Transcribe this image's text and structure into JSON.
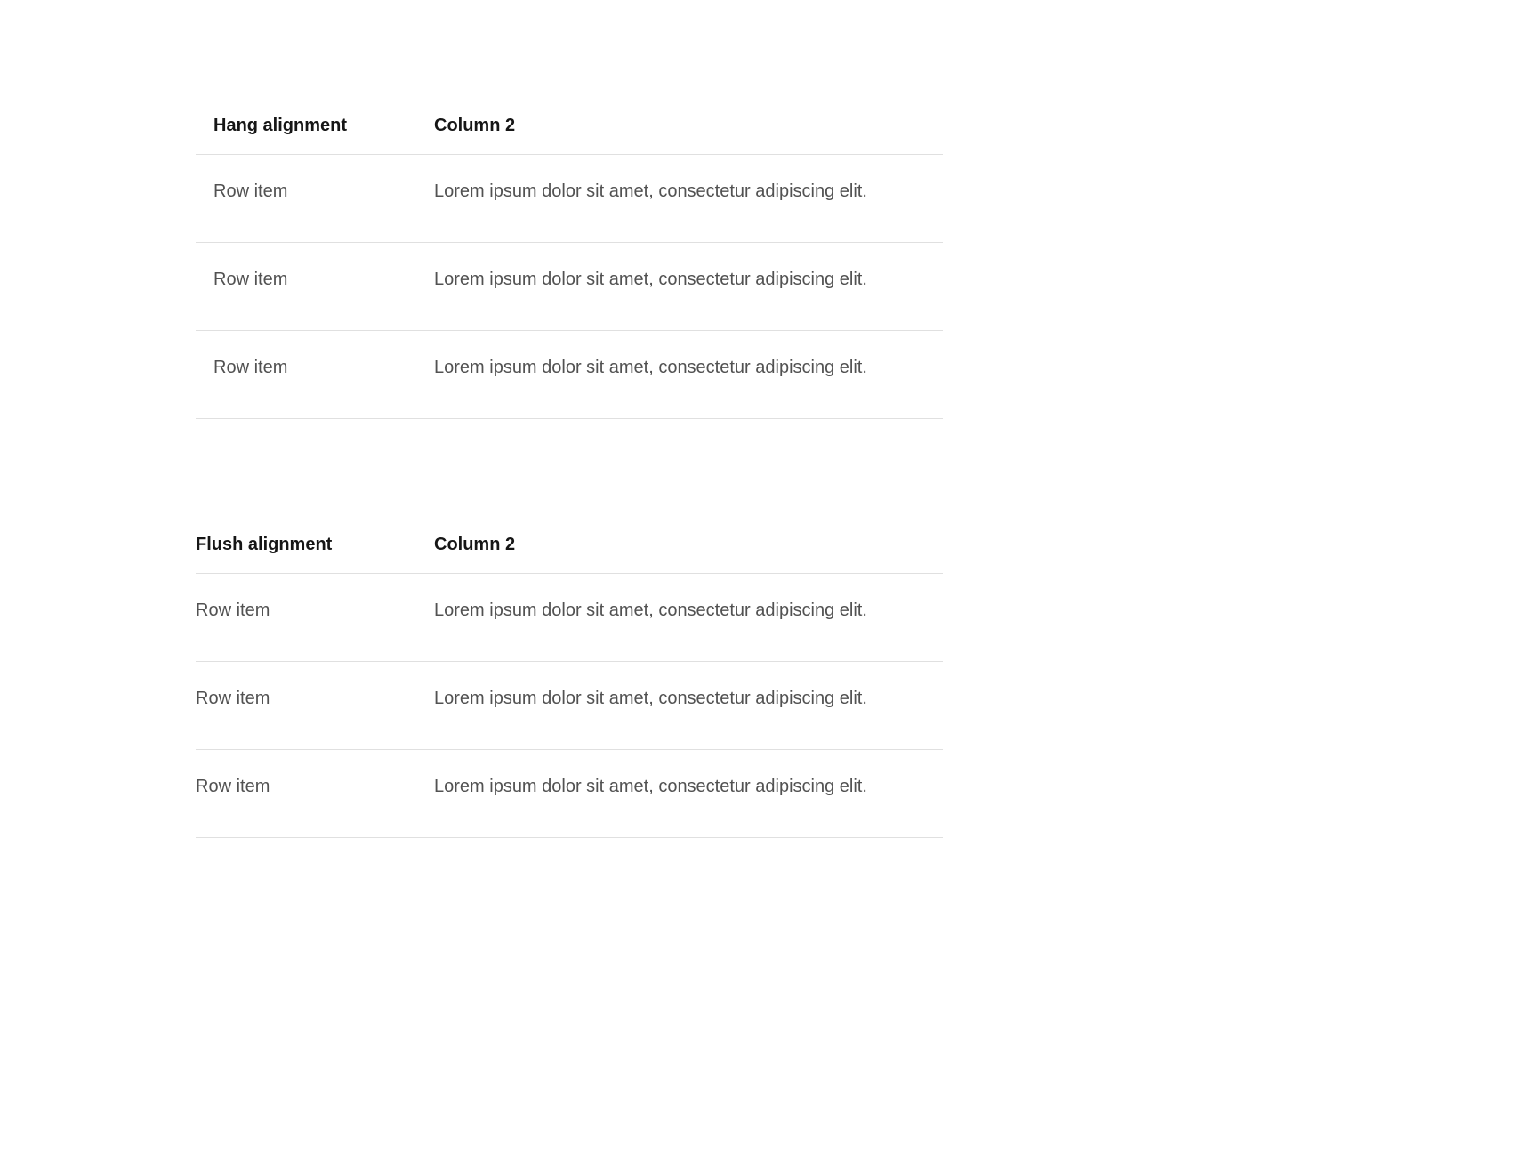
{
  "tables": [
    {
      "alignment": "hang",
      "headers": {
        "col1": "Hang alignment",
        "col2": "Column 2"
      },
      "rows": [
        {
          "label": "Row item",
          "content": "Lorem ipsum dolor sit amet, consectetur adipiscing elit."
        },
        {
          "label": "Row item",
          "content": "Lorem ipsum dolor sit amet, consectetur adipiscing elit."
        },
        {
          "label": "Row item",
          "content": "Lorem ipsum dolor sit amet, consectetur adipiscing elit."
        }
      ]
    },
    {
      "alignment": "flush",
      "headers": {
        "col1": "Flush alignment",
        "col2": "Column 2"
      },
      "rows": [
        {
          "label": "Row item",
          "content": "Lorem ipsum dolor sit amet, consectetur adipiscing elit."
        },
        {
          "label": "Row item",
          "content": "Lorem ipsum dolor sit amet, consectetur adipiscing elit."
        },
        {
          "label": "Row item",
          "content": "Lorem ipsum dolor sit amet, consectetur adipiscing elit."
        }
      ]
    }
  ]
}
